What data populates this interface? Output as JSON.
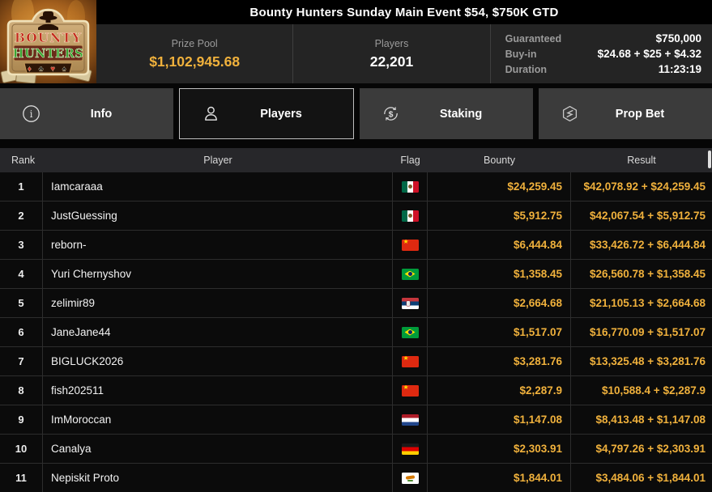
{
  "header": {
    "title": "Bounty Hunters Sunday Main Event $54, $750K GTD",
    "logo": {
      "line1": "BOUNTY",
      "line2": "HUNTERS",
      "suits": [
        "♦",
        "♣",
        "♥",
        "♠"
      ]
    },
    "stats": {
      "prize_pool_label": "Prize Pool",
      "prize_pool_value": "$1,102,945.68",
      "players_label": "Players",
      "players_value": "22,201",
      "details": [
        {
          "label": "Guaranteed",
          "value": "$750,000"
        },
        {
          "label": "Buy-in",
          "value": "$24.68 + $25 + $4.32"
        },
        {
          "label": "Duration",
          "value": "11:23:19"
        }
      ]
    }
  },
  "tabs": [
    {
      "label": "Info",
      "icon": "info-icon",
      "active": false
    },
    {
      "label": "Players",
      "icon": "players-icon",
      "active": true
    },
    {
      "label": "Staking",
      "icon": "staking-icon",
      "active": false
    },
    {
      "label": "Prop Bet",
      "icon": "prop-bet-icon",
      "active": false
    }
  ],
  "table": {
    "columns": [
      "Rank",
      "Player",
      "Flag",
      "Bounty",
      "Result"
    ],
    "rows": [
      {
        "rank": "1",
        "player": "Iamcaraaa",
        "flag": "mx",
        "bounty": "$24,259.45",
        "result": "$42,078.92 + $24,259.45"
      },
      {
        "rank": "2",
        "player": "JustGuessing",
        "flag": "mx",
        "bounty": "$5,912.75",
        "result": "$42,067.54 + $5,912.75"
      },
      {
        "rank": "3",
        "player": "reborn-",
        "flag": "cn",
        "bounty": "$6,444.84",
        "result": "$33,426.72 + $6,444.84"
      },
      {
        "rank": "4",
        "player": "Yuri Chernyshov",
        "flag": "br",
        "bounty": "$1,358.45",
        "result": "$26,560.78 + $1,358.45"
      },
      {
        "rank": "5",
        "player": "zelimir89",
        "flag": "rs",
        "bounty": "$2,664.68",
        "result": "$21,105.13 + $2,664.68"
      },
      {
        "rank": "6",
        "player": "JaneJane44",
        "flag": "br",
        "bounty": "$1,517.07",
        "result": "$16,770.09 + $1,517.07"
      },
      {
        "rank": "7",
        "player": "BIGLUCK2026",
        "flag": "cn",
        "bounty": "$3,281.76",
        "result": "$13,325.48 + $3,281.76"
      },
      {
        "rank": "8",
        "player": "fish202511",
        "flag": "cn",
        "bounty": "$2,287.9",
        "result": "$10,588.4 + $2,287.9"
      },
      {
        "rank": "9",
        "player": "ImMoroccan",
        "flag": "nl",
        "bounty": "$1,147.08",
        "result": "$8,413.48 + $1,147.08"
      },
      {
        "rank": "10",
        "player": "Canalya",
        "flag": "de",
        "bounty": "$2,303.91",
        "result": "$4,797.26 + $2,303.91"
      },
      {
        "rank": "11",
        "player": "Nepiskit Proto",
        "flag": "cy",
        "bounty": "$1,844.01",
        "result": "$3,484.06 + $1,844.01"
      }
    ]
  },
  "colors": {
    "accent_gold": "#f0b13c",
    "panel_bg": "#242424",
    "tab_inactive_bg": "#3b3b3b",
    "tab_active_border": "#bfbfbf",
    "row_bg": "#0b0b0b"
  }
}
